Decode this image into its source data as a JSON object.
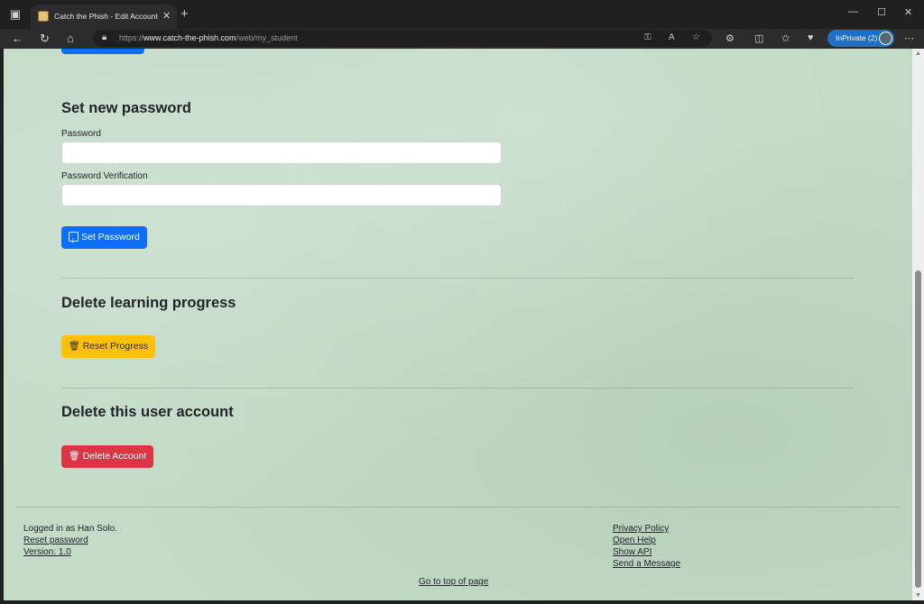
{
  "browser": {
    "tab_title": "Catch the Phish - Edit Account",
    "url_prefix": "https://",
    "url_host": "www.catch-the-phish.com",
    "url_path": "/web/my_student",
    "inprivate_label": "InPrivate (2)"
  },
  "password_section": {
    "title": "Set new password",
    "password_label": "Password",
    "password_value": "",
    "verification_label": "Password Verification",
    "verification_value": "",
    "submit_label": "Set Password"
  },
  "progress_section": {
    "title": "Delete learning progress",
    "reset_label": "Reset Progress"
  },
  "account_section": {
    "title": "Delete this user account",
    "delete_label": "Delete Account"
  },
  "footer": {
    "logged_in_text": "Logged in as Han Solo.",
    "reset_password": "Reset password",
    "version": "Version: 1.0",
    "privacy_policy": "Privacy Policy",
    "open_help": "Open Help",
    "show_api": "Show API",
    "send_message": "Send a Message",
    "go_top": "Go to top of page"
  },
  "colors": {
    "primary": "#0d6efd",
    "warning": "#ffc107",
    "danger": "#dc3545",
    "page_background": "#c3dbc7"
  }
}
